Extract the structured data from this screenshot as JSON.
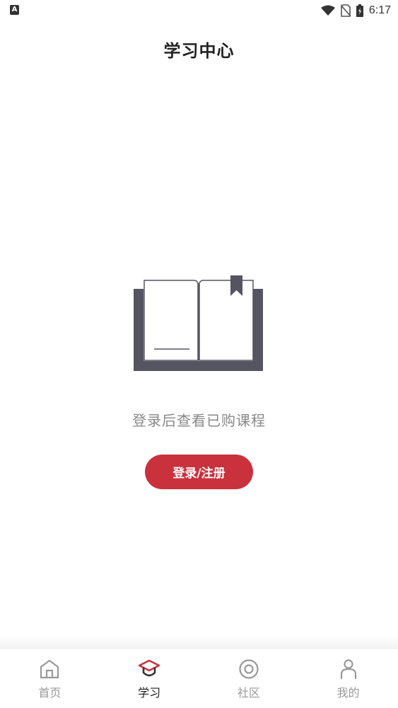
{
  "status_bar": {
    "time": "6:17",
    "app_icon_letter": "A"
  },
  "header": {
    "title": "学习中心"
  },
  "empty_state": {
    "message": "登录后查看已购课程",
    "login_button_label": "登录/注册"
  },
  "tabs": [
    {
      "label": "首页",
      "icon": "home-icon",
      "active": false
    },
    {
      "label": "学习",
      "icon": "graduation-cap-icon",
      "active": true
    },
    {
      "label": "社区",
      "icon": "community-icon",
      "active": false
    },
    {
      "label": "我的",
      "icon": "profile-icon",
      "active": false
    }
  ],
  "colors": {
    "accent": "#c9313d",
    "illustration": "#555561",
    "inactive_tab": "#999999"
  }
}
